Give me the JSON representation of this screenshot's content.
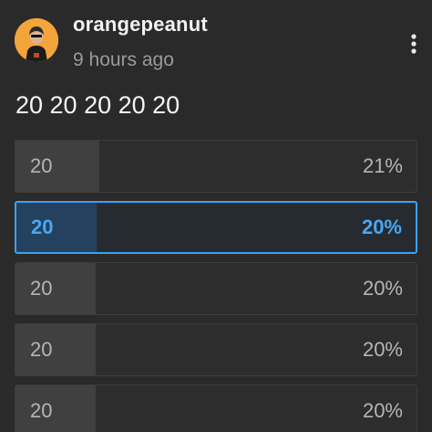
{
  "post": {
    "author": "orangepeanut",
    "avatar_icon": "user-avatar-icon",
    "time_ago": "9 hours ago",
    "title": "20 20 20 20 20",
    "more_icon": "more-vertical-icon"
  },
  "poll": {
    "options": [
      {
        "label": "20",
        "percent_text": "21%",
        "percent": 21,
        "selected": false
      },
      {
        "label": "20",
        "percent_text": "20%",
        "percent": 20,
        "selected": true
      },
      {
        "label": "20",
        "percent_text": "20%",
        "percent": 20,
        "selected": false
      },
      {
        "label": "20",
        "percent_text": "20%",
        "percent": 20,
        "selected": false
      },
      {
        "label": "20",
        "percent_text": "20%",
        "percent": 20,
        "selected": false
      }
    ]
  },
  "colors": {
    "background": "#2a2a2a",
    "accent": "#3ea0f0",
    "avatar_bg": "#f3a53c",
    "muted_text": "#9a9a9a"
  }
}
